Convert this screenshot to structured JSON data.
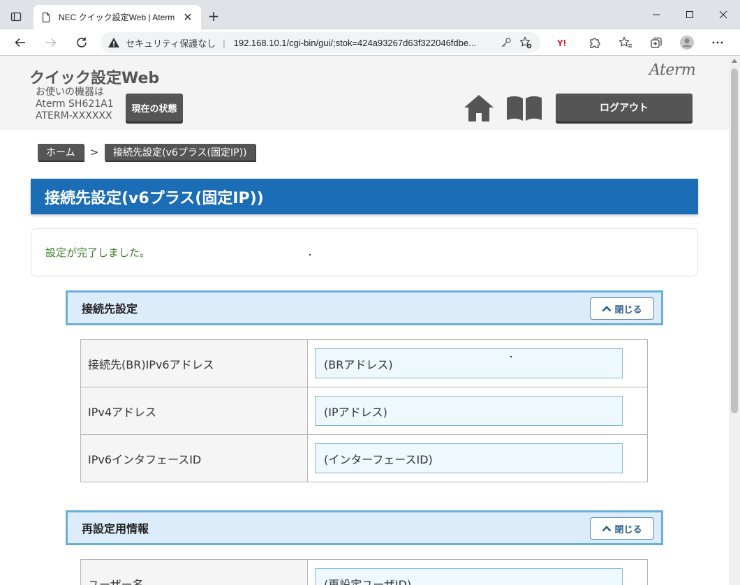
{
  "browser": {
    "tab_title": "NEC クイック設定Web | Aterm",
    "security_label": "セキュリティ保護なし",
    "separator": "|",
    "url": "192.168.10.1/cgi-bin/gui/;stok=424a93267d63f322046fdbe..."
  },
  "header": {
    "site_title": "クイック設定Web",
    "device_line1": "お使いの機器は",
    "device_line2": "Aterm SH621A1",
    "device_line3": "ATERM-XXXXXX",
    "status_button": "現在の状態",
    "brand": "Aterm",
    "logout_button": "ログアウト"
  },
  "breadcrumb": {
    "home": "ホーム",
    "separator": ">",
    "current": "接続先設定(v6プラス(固定IP))"
  },
  "page_title": "接続先設定(v6プラス(固定IP))",
  "message": "設定が完了しました。",
  "sections": [
    {
      "title": "接続先設定",
      "close_label": "閉じる",
      "rows": [
        {
          "label": "接続先(BR)IPv6アドレス",
          "value": "(BRアドレス)"
        },
        {
          "label": "IPv4アドレス",
          "value": "(IPアドレス)"
        },
        {
          "label": "IPv6インタフェースID",
          "value": "(インターフェースID)"
        }
      ]
    },
    {
      "title": "再設定用情報",
      "close_label": "閉じる",
      "rows": [
        {
          "label": "ユーザー名",
          "value": "(再設定ユーザID)"
        }
      ]
    }
  ]
}
